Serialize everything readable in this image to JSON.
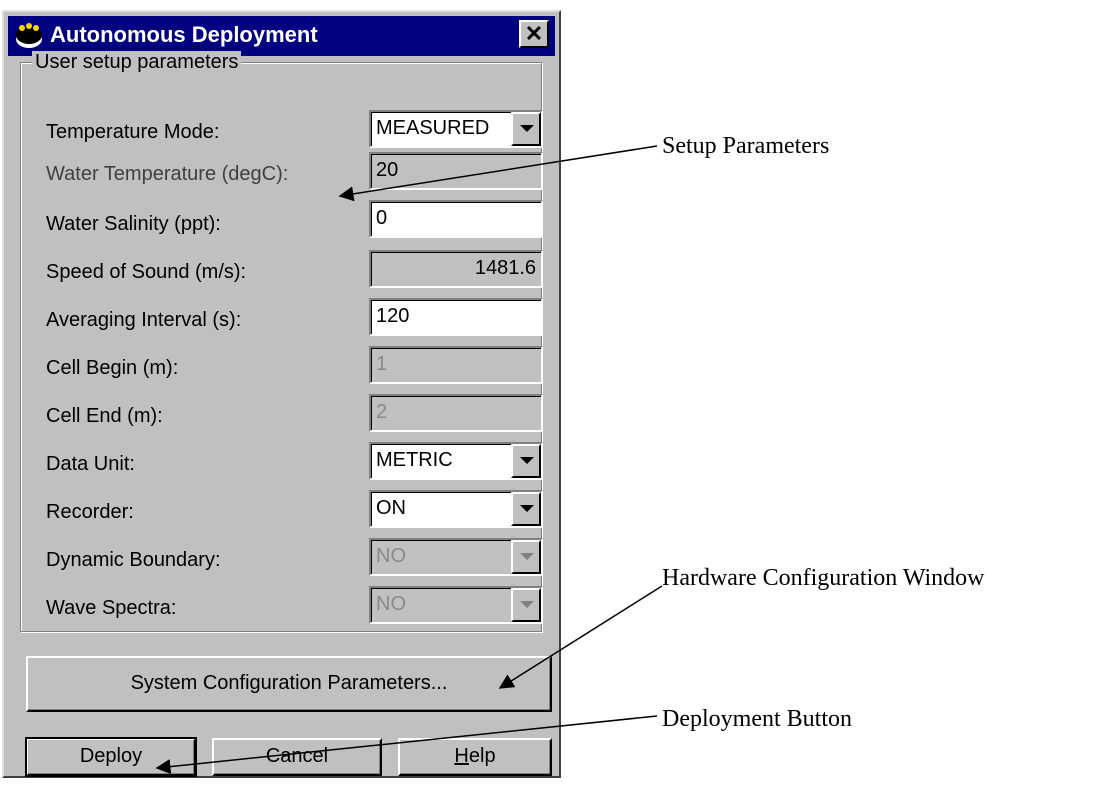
{
  "dialog": {
    "title": "Autonomous Deployment",
    "close_glyph": "✕",
    "group_title": "User setup parameters",
    "rows": [
      {
        "label": "Temperature Mode:",
        "value": "MEASURED",
        "kind": "combo"
      },
      {
        "label": "Water Temperature (degC):",
        "value": "20",
        "kind": "readonly"
      },
      {
        "label": "Water Salinity (ppt):",
        "value": "0",
        "kind": "input"
      },
      {
        "label": "Speed of Sound (m/s):",
        "value": "1481.6",
        "kind": "readonly"
      },
      {
        "label": "Averaging Interval (s):",
        "value": "120",
        "kind": "input"
      },
      {
        "label": "Cell Begin (m):",
        "value": "1",
        "kind": "disabled"
      },
      {
        "label": "Cell End (m):",
        "value": "2",
        "kind": "disabled"
      },
      {
        "label": "Data Unit:",
        "value": "METRIC",
        "kind": "combo"
      },
      {
        "label": "Recorder:",
        "value": "ON",
        "kind": "combo"
      },
      {
        "label": "Dynamic Boundary:",
        "value": "NO",
        "kind": "combo-disabled"
      },
      {
        "label": "Wave Spectra:",
        "value": "NO",
        "kind": "combo-disabled"
      }
    ],
    "system_config_button": "System  Configuration  Parameters...",
    "buttons": {
      "deploy": "Deploy",
      "cancel": "Cancel",
      "help_prefix": "H",
      "help_rest": "elp"
    }
  },
  "annotations": {
    "setup": "Setup Parameters",
    "hardware": "Hardware Configuration Window",
    "deployment": "Deployment Button"
  },
  "icons": [
    "app-icon",
    "close-icon",
    "dropdown-arrow-icon"
  ],
  "colors": {
    "titlebar": "#000080",
    "face": "#c0c0c0",
    "disabled_text": "#8a8a8a"
  }
}
